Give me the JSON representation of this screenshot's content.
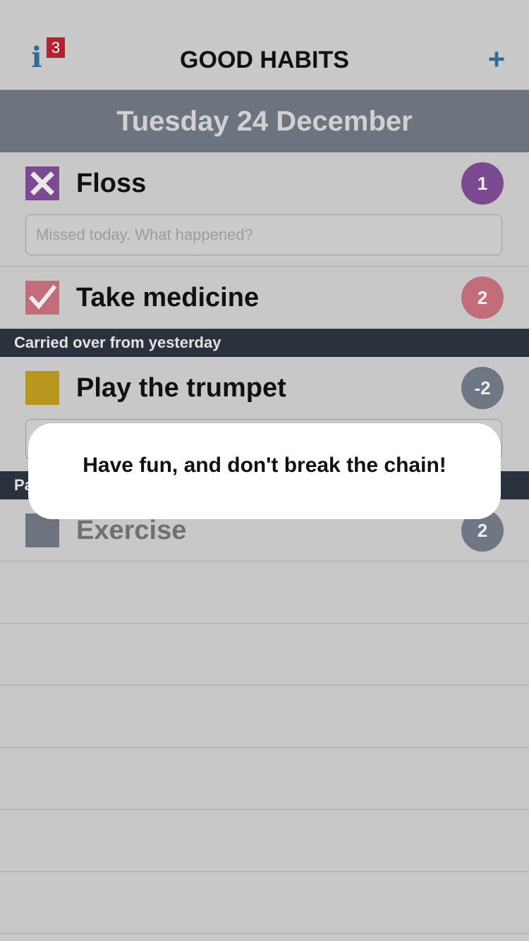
{
  "header": {
    "info_glyph": "i",
    "info_badge": "3",
    "title": "GOOD HABITS",
    "add_glyph": "+"
  },
  "date": "Tuesday 24 December",
  "habits": [
    {
      "name": "Floss",
      "count": "1",
      "status": "missed",
      "color": "#7b4a90",
      "note_placeholder": "Missed today. What happened?"
    },
    {
      "name": "Take medicine",
      "count": "2",
      "status": "done",
      "color": "#c26d79"
    }
  ],
  "section_carried": "Carried over from yesterday",
  "carried_habits": [
    {
      "name": "Play the trumpet",
      "count": "-2",
      "status": "pending",
      "color": "#b9961e"
    }
  ],
  "section_partial": "Pa",
  "paused_habits": [
    {
      "name": "Exercise",
      "count": "2",
      "status": "pending",
      "color": "#6c7480"
    }
  ],
  "toast": {
    "message": "Have fun, and don't break the chain!"
  },
  "colors": {
    "accent": "#2f6b99",
    "badge": "#b3222e",
    "date_bar": "#6c7480",
    "section_bar": "#2a323e",
    "count_gray": "#707784"
  }
}
